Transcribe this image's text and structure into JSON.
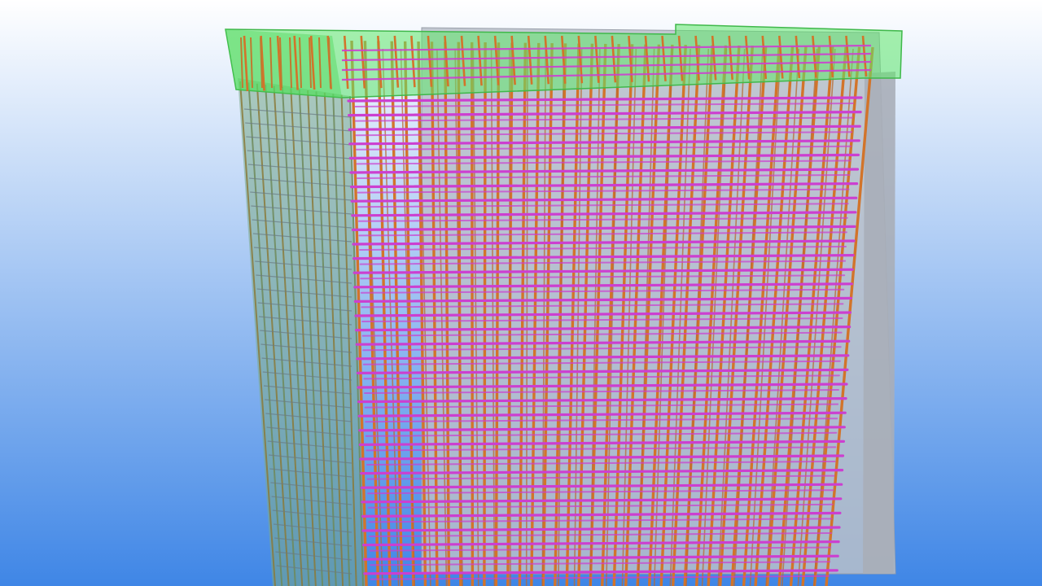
{
  "viewport": {
    "background_top": "#ffffff",
    "background_bottom": "#3f86e6"
  },
  "model": {
    "concrete_color": "#b9bfc9",
    "cap_color": "#5fe86a",
    "vertical_rebar_color": "#d2742a",
    "horizontal_rebar_color": "#cc3fd0",
    "side_face_color": "#7aa98a"
  }
}
